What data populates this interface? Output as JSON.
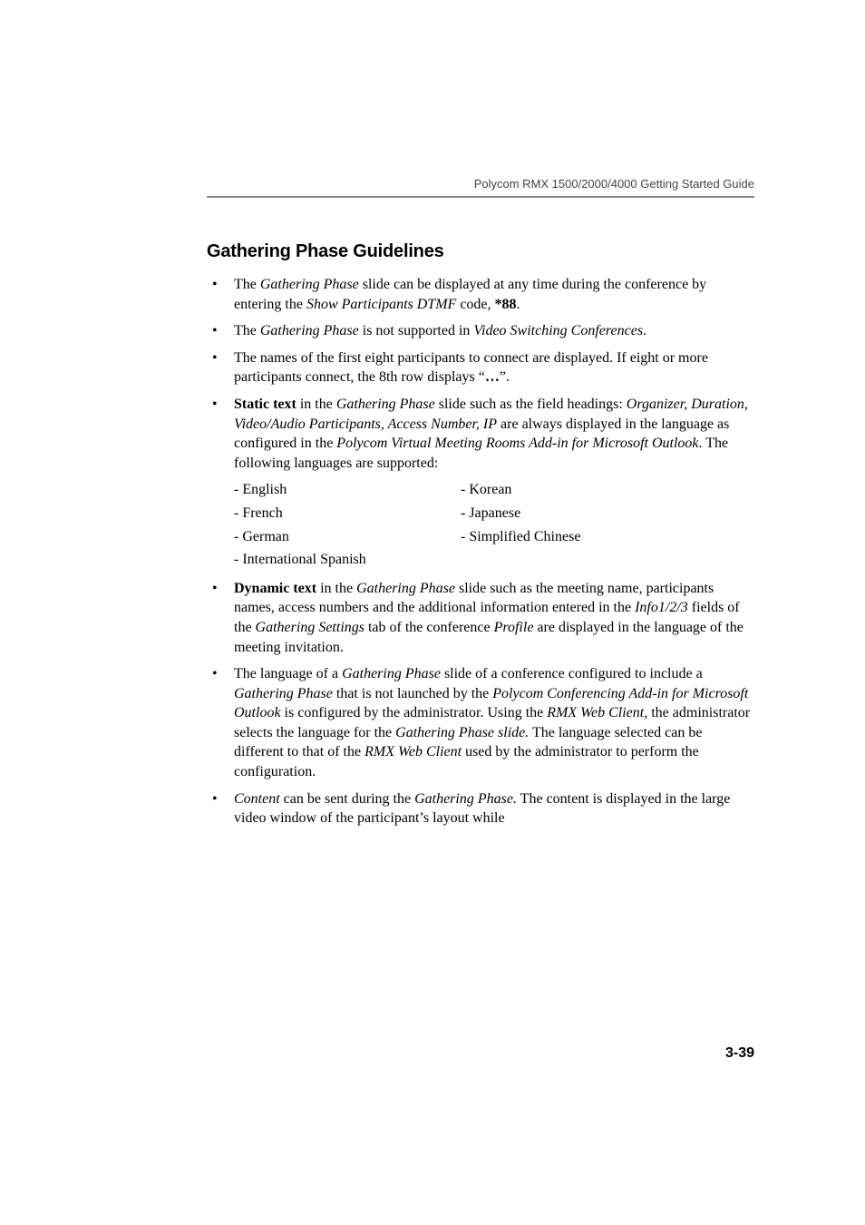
{
  "header": {
    "running_title": "Polycom RMX 1500/2000/4000 Getting Started Guide"
  },
  "section": {
    "title": "Gathering Phase Guidelines"
  },
  "bullets": {
    "b1": {
      "pre": "The ",
      "i1": "Gathering Phase",
      "mid1": " slide can be displayed at any time during the conference by entering the ",
      "i2": "Show Participants DTMF",
      "mid2": " code, ",
      "bold1": "*88",
      "end": "."
    },
    "b2": {
      "pre": "The ",
      "i1": "Gathering Phase",
      "mid1": " is not supported in ",
      "i2": "Video Switching Conferences",
      "end": "."
    },
    "b3": {
      "pre": "The names of the first eight participants to connect are displayed. If eight or more participants connect, the 8th row displays “",
      "bold1": "…",
      "end": "”."
    },
    "b4": {
      "bold1": "Static text",
      "mid1": " in the ",
      "i1": "Gathering Phase",
      "mid2": " slide such as the field headings: ",
      "i2": "Organizer, Duration, Video/Audio Participants, Access Number, IP",
      "mid3": " are always displayed in the language as configured in the ",
      "i3": "Polycom Virtual Meeting Rooms Add-in for Microsoft Outlook",
      "end": ". The following languages are supported:"
    },
    "langs": {
      "r0c0": "- English",
      "r0c1": "- Korean",
      "r1c0": "- French",
      "r1c1": "- Japanese",
      "r2c0": "- German",
      "r2c1": "- Simplified Chinese",
      "r3c0": "- International Spanish"
    },
    "b5": {
      "bold1": "Dynamic text",
      "mid1": " in the ",
      "i1": "Gathering Phase",
      "mid2": " slide such as the meeting name, participants names, access numbers and the additional information entered in the ",
      "i2": "Info1/2/3",
      "mid3": " fields of the ",
      "i3": "Gathering Settings",
      "mid4": " tab of the conference ",
      "i4": "Profile",
      "end": " are displayed in the language of the meeting invitation."
    },
    "b6": {
      "pre": "The language of a ",
      "i1": "Gathering Phase",
      "mid1": " slide of a conference configured to include a ",
      "i2": "Gathering Phase",
      "mid2": " that is not launched by the ",
      "i3": "Polycom Conferencing Add-in for Microsoft Outlook",
      "mid3": " is configured by the administrator. Using the ",
      "i4": "RMX Web Client,",
      "mid4": " the administrator selects the language for the ",
      "i5": "Gathering Phase slide.",
      "mid5": " The language selected can be different to that of the ",
      "i6": "RMX Web Client",
      "end": " used by the administrator to perform the configuration."
    },
    "b7": {
      "i1": "Content",
      "mid1": " can be sent during the ",
      "i2": "Gathering Phase.",
      "end": " The content is displayed in the large video window of the participant’s layout while"
    }
  },
  "page_number": "3-39"
}
